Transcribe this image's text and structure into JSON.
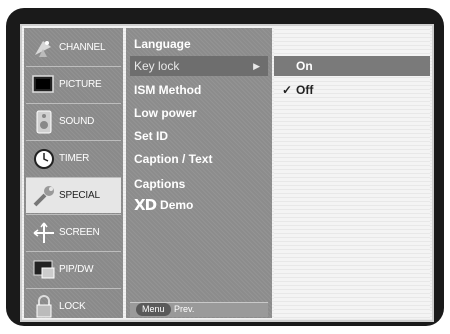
{
  "nav": {
    "items": [
      {
        "label": "CHANNEL",
        "icon": "satellite-dish-icon"
      },
      {
        "label": "PICTURE",
        "icon": "monitor-icon"
      },
      {
        "label": "SOUND",
        "icon": "speaker-icon"
      },
      {
        "label": "TIMER",
        "icon": "clock-icon"
      },
      {
        "label": "SPECIAL",
        "icon": "wrench-icon"
      },
      {
        "label": "SCREEN",
        "icon": "screen-adjust-icon"
      },
      {
        "label": "PIP/DW",
        "icon": "pip-icon"
      },
      {
        "label": "LOCK",
        "icon": "padlock-icon"
      }
    ],
    "active_index": 4
  },
  "menu": {
    "items": [
      {
        "label": "Language"
      },
      {
        "label": "Key lock"
      },
      {
        "label": "ISM Method"
      },
      {
        "label": "Low power"
      },
      {
        "label": "Set ID"
      },
      {
        "label": "Caption / Text"
      },
      {
        "label": "Captions"
      },
      {
        "logo": "XD",
        "label": "Demo"
      }
    ],
    "selected_index": 1,
    "arrow": "▶",
    "footer": {
      "menu_button": "Menu",
      "prev_label": "Prev."
    }
  },
  "options": {
    "items": [
      {
        "label": "On",
        "checked": false
      },
      {
        "label": "Off",
        "checked": true
      }
    ],
    "highlighted_index": 0,
    "check_mark": "✓"
  },
  "colors": {
    "panel_gray": "#8c8c8c",
    "active_tab": "#e6e6e6",
    "highlight": "#7a7a7a"
  }
}
